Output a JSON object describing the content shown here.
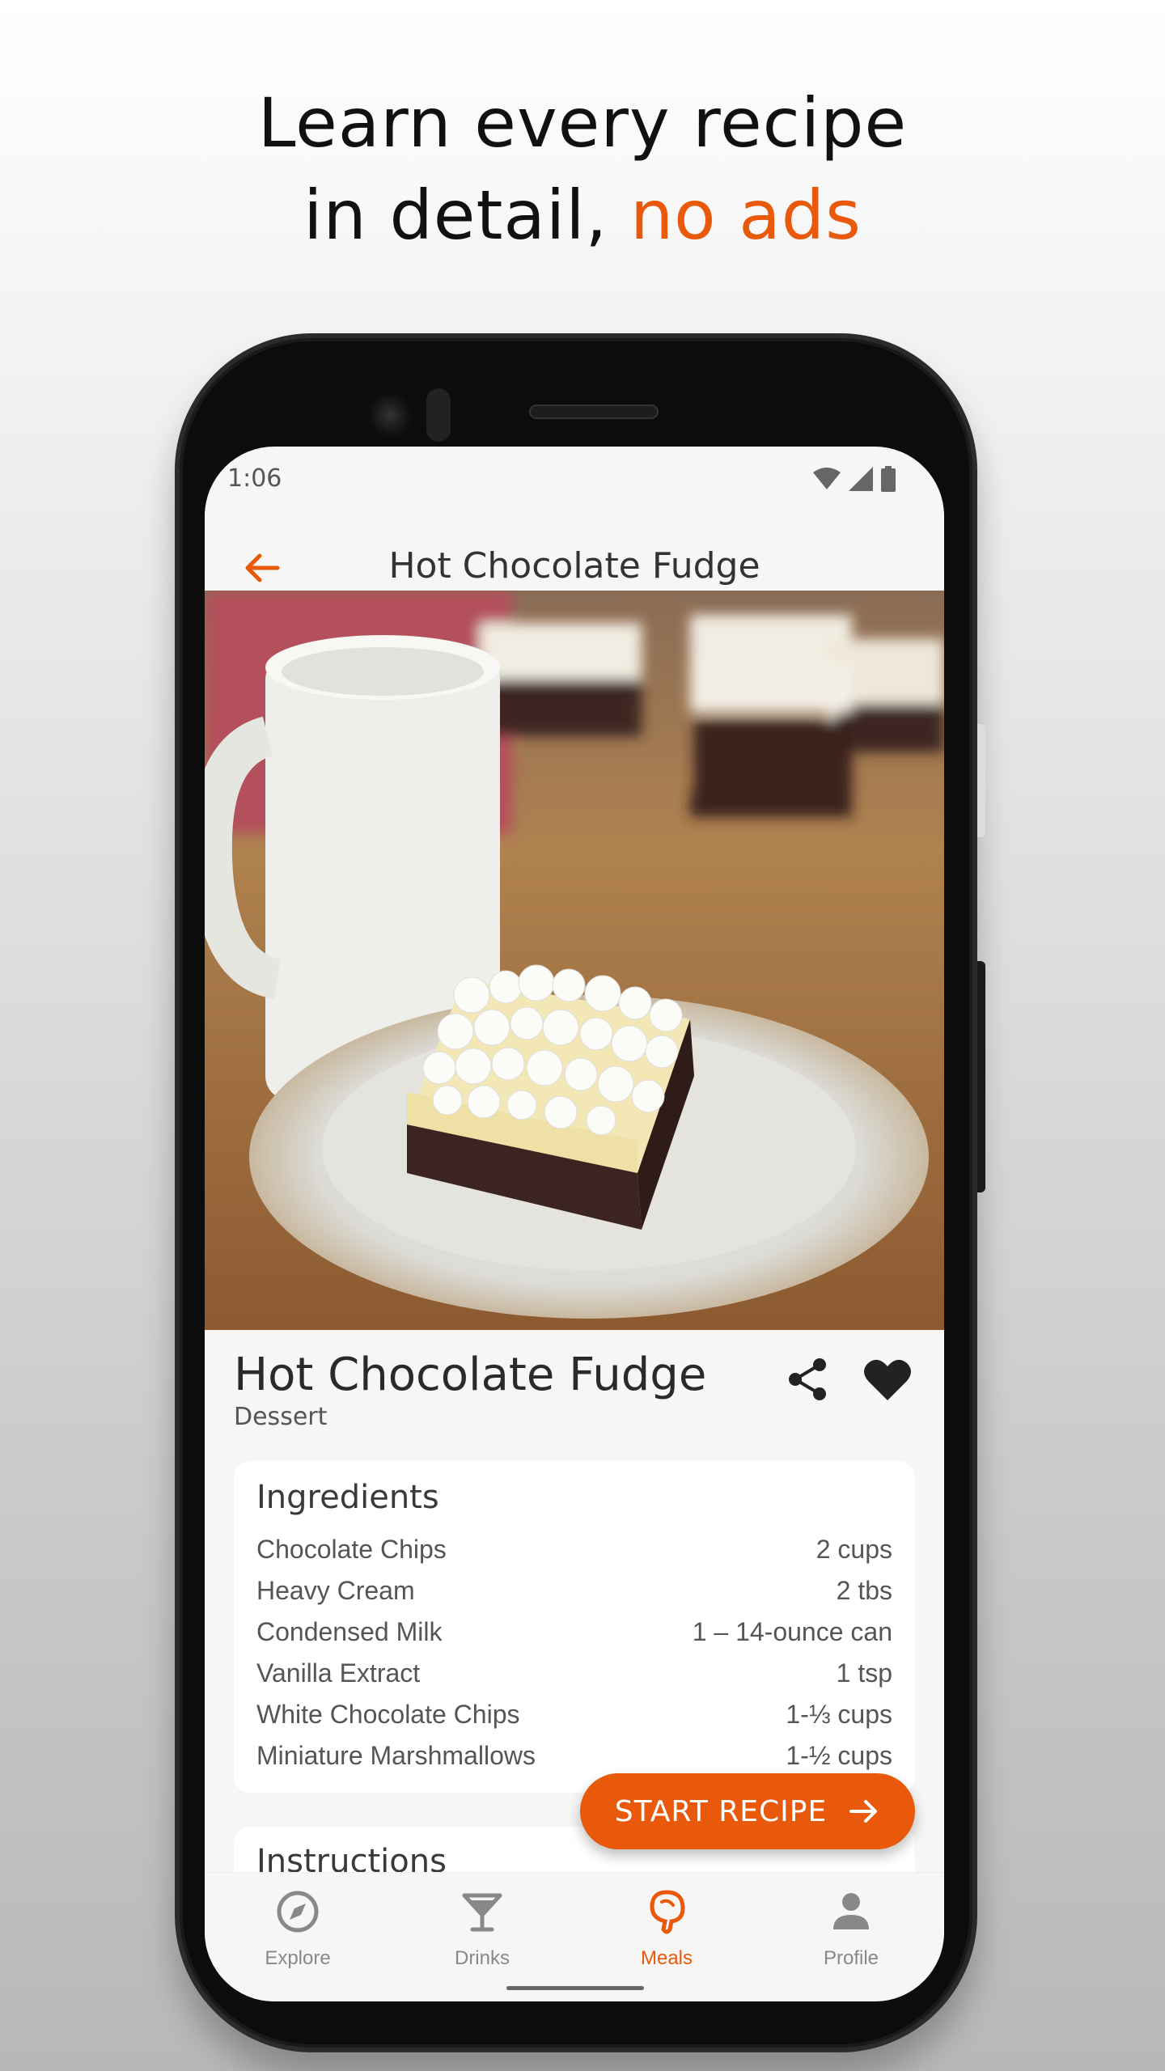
{
  "headline": {
    "line1": "Learn every recipe",
    "line2_prefix": "in detail, ",
    "line2_accent": "no ads"
  },
  "status": {
    "time": "1:06"
  },
  "appbar": {
    "title": "Hot Chocolate Fudge"
  },
  "recipe": {
    "name": "Hot Chocolate Fudge",
    "category": "Dessert"
  },
  "ingredients": {
    "heading": "Ingredients",
    "items": [
      {
        "name": "Chocolate Chips",
        "qty": "2 cups"
      },
      {
        "name": "Heavy Cream",
        "qty": "2 tbs"
      },
      {
        "name": "Condensed Milk",
        "qty": "1 – 14-ounce can"
      },
      {
        "name": "Vanilla Extract",
        "qty": "1 tsp"
      },
      {
        "name": "White Chocolate Chips",
        "qty": "1-⅓ cups"
      },
      {
        "name": "Miniature Marshmallows",
        "qty": "1-½ cups"
      }
    ]
  },
  "instructions": {
    "heading": "Instructions"
  },
  "start_button": {
    "label": "START RECIPE"
  },
  "nav": {
    "items": [
      {
        "label": "Explore",
        "icon": "compass-icon"
      },
      {
        "label": "Drinks",
        "icon": "cocktail-icon"
      },
      {
        "label": "Meals",
        "icon": "drumstick-icon"
      },
      {
        "label": "Profile",
        "icon": "person-icon"
      }
    ],
    "active": "Meals"
  },
  "colors": {
    "accent": "#e8590c",
    "text": "#2a2a2a"
  }
}
